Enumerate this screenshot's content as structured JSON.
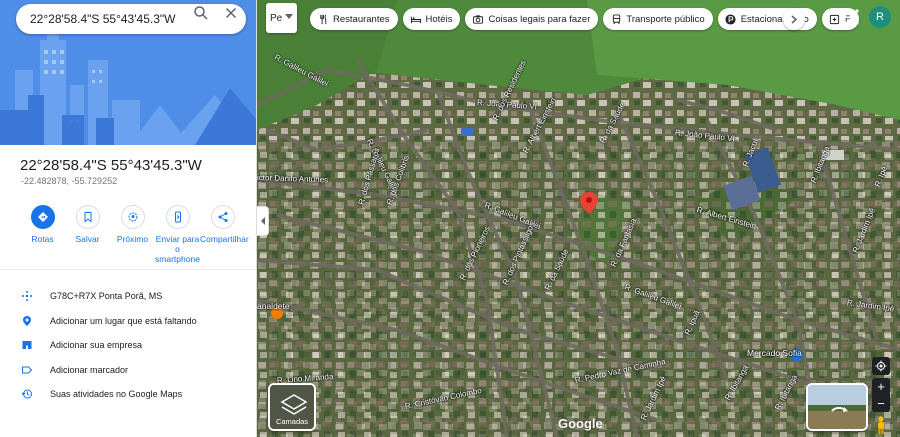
{
  "search": {
    "value": "22°28'58.4\"S 55°43'45.3\"W"
  },
  "place": {
    "title": "22°28'58.4\"S 55°43'45.3\"W",
    "decimal": "-22.482878, -55.729252"
  },
  "actions": [
    {
      "label": "Rotas",
      "icon": "directions-icon"
    },
    {
      "label": "Salvar",
      "icon": "bookmark-icon"
    },
    {
      "label": "Próximo",
      "icon": "nearby-icon"
    },
    {
      "label": "Enviar para o smartphone",
      "icon": "phone-icon"
    },
    {
      "label": "Compartilhar",
      "icon": "share-icon"
    }
  ],
  "info": [
    {
      "text": "G78C+R7X Ponta Porã, MS",
      "icon": "plus-code-icon"
    },
    {
      "text": "Adicionar um lugar que está faltando",
      "icon": "add-place-icon"
    },
    {
      "text": "Adicionar sua empresa",
      "icon": "business-icon"
    },
    {
      "text": "Adicionar marcador",
      "icon": "label-icon"
    },
    {
      "text": "Suas atividades no Google Maps",
      "icon": "history-icon"
    }
  ],
  "layer_type": "Pe",
  "chips": [
    {
      "label": "Restaurantes",
      "icon": "restaurant-icon"
    },
    {
      "label": "Hotéis",
      "icon": "hotel-icon"
    },
    {
      "label": "Coisas legais para fazer",
      "icon": "camera-icon"
    },
    {
      "label": "Transporte público",
      "icon": "transit-icon"
    },
    {
      "label": "Estacionamento",
      "icon": "parking-icon"
    },
    {
      "label": "F",
      "icon": "pharmacy-icon"
    }
  ],
  "avatar_initial": "R",
  "layers_label": "Camadas",
  "google_logo": "Google",
  "zoom": {
    "in": "+",
    "out": "−"
  },
  "streets": {
    "galileu_top": "R. Galileu Galilei",
    "joao_paulo_1": "R. João Paulo VI",
    "joao_paulo_2": "R. João Paulo VI",
    "galileu_left": "R. Galileu Galilei",
    "dos_residentes": "R. dos Residentes",
    "albert_einstein_1": "R. Albert Einstein",
    "albert_einstein_2": "R. Albert Einstein",
    "da_saude_1": "R. da Saúde",
    "jacui": "R. Jacuí",
    "ibitanga_1": "R. Ibitanga",
    "ipe": "R. Ipê",
    "victor": "ictor Danilo Antunes",
    "dos_passaros": "R. dos Pássaros",
    "dos_colibris": "R. dos Colibris",
    "galileu_mid": "R. Galileu Galilei",
    "dos_pioneiros": "R. dos Pioneiros",
    "dos_pintassilgos": "R. dos Pintassilgos",
    "da_saude_2": "R. da Saúde",
    "da_fantasia": "R. da Fantasia",
    "galileu_lower": "R. Galileu Galilei",
    "jadim_1": "R. Jardim Ipê",
    "jardim_2": "R. Jardim Ipê",
    "pedro_vaz": "R. Pedro Vaz de Caminha",
    "cristovao": "R. Cristóvão Colombo",
    "lino": "R. Lino Miranda",
    "ibitanga_2": "R. Ibitanga",
    "ipuas": "R. Ipuã",
    "bitanga_3": "R. Ibitanga",
    "sadim": "R. Jardim Ipê"
  },
  "poi": {
    "mercado": "Mercado Sofia",
    "analdete": "analdete"
  },
  "colors": {
    "accent": "#1a73e8",
    "hero_bg": "#4f8ee8",
    "pin": "#ea4335",
    "avatar": "#1e8e7e"
  }
}
